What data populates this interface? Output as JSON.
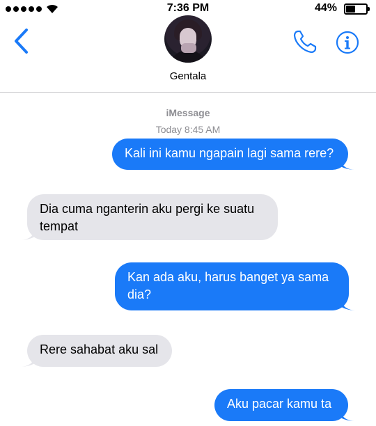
{
  "status_bar": {
    "time": "7:36 PM",
    "battery_percent": "44%",
    "battery_level": 0.44,
    "signal_bars": 5
  },
  "header": {
    "contact_name": "Gentala",
    "icons": [
      "back-chevron-icon",
      "avatar",
      "phone-icon",
      "info-icon"
    ]
  },
  "conversation": {
    "service": "iMessage",
    "timestamp": "Today 8:45 AM",
    "messages": [
      {
        "direction": "out",
        "text": "Kali ini kamu ngapain lagi sama rere?"
      },
      {
        "direction": "in",
        "text": "Dia cuma nganterin aku pergi ke suatu tempat"
      },
      {
        "direction": "out",
        "text": "Kan ada aku, harus banget ya sama dia?"
      },
      {
        "direction": "in",
        "text": "Rere sahabat aku sal"
      },
      {
        "direction": "out",
        "text": "Aku pacar kamu ta"
      }
    ]
  },
  "colors": {
    "accent": "#1a7af8",
    "incoming_bubble": "#e5e5ea",
    "meta_text": "#8e8e93"
  }
}
